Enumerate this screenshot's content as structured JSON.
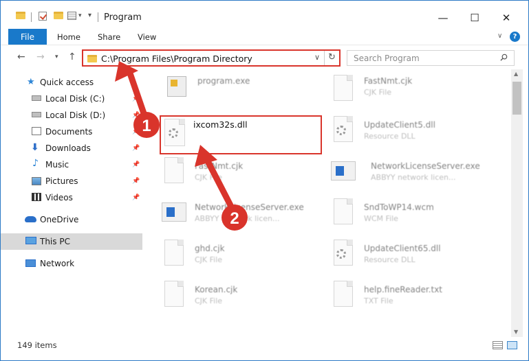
{
  "window": {
    "title": "Program",
    "controls": {
      "minimize": "—",
      "maximize": "☐",
      "close": "✕"
    }
  },
  "ribbon": {
    "tabs": [
      "File",
      "Home",
      "Share",
      "View"
    ],
    "help": "?"
  },
  "nav": {
    "address": "C:\\Program Files\\Program Directory",
    "search_placeholder": "Search Program"
  },
  "sidebar": {
    "items": [
      {
        "label": "Quick access",
        "icon": "star-icon",
        "pinned": false
      },
      {
        "label": "Local Disk (C:)",
        "icon": "drive-icon",
        "pinned": true
      },
      {
        "label": "Local Disk (D:)",
        "icon": "drive-icon",
        "pinned": true
      },
      {
        "label": "Documents",
        "icon": "documents-icon",
        "pinned": true
      },
      {
        "label": "Downloads",
        "icon": "download-icon",
        "pinned": true
      },
      {
        "label": "Music",
        "icon": "music-icon",
        "pinned": true
      },
      {
        "label": "Pictures",
        "icon": "pictures-icon",
        "pinned": true
      },
      {
        "label": "Videos",
        "icon": "videos-icon",
        "pinned": true
      },
      {
        "label": "OneDrive",
        "icon": "cloud-icon",
        "pinned": false
      },
      {
        "label": "This PC",
        "icon": "computer-icon",
        "pinned": false,
        "selected": true
      },
      {
        "label": "Network",
        "icon": "network-icon",
        "pinned": false
      }
    ]
  },
  "files": {
    "left": [
      {
        "name": "program.exe",
        "type": "",
        "icon": "exe-icon"
      },
      {
        "name": "ixcom32s.dll",
        "type": "",
        "icon": "dll-gear-icon",
        "highlighted": true
      },
      {
        "name": "FastNmt.cjk",
        "type": "CJK File",
        "icon": "file-icon"
      },
      {
        "name": "NetworkLicenseServer.exe",
        "type": "ABBYY network licen...",
        "icon": "app-window-icon"
      },
      {
        "name": "ghd.cjk",
        "type": "CJK File",
        "icon": "file-icon"
      },
      {
        "name": "Korean.cjk",
        "type": "CJK File",
        "icon": "file-icon"
      }
    ],
    "right": [
      {
        "name": "FastNmt.cjk",
        "type": "CJK File",
        "icon": "file-icon"
      },
      {
        "name": "UpdateClient5.dll",
        "type": "Resource DLL",
        "icon": "dll-gear-icon"
      },
      {
        "name": "NetworkLicenseServer.exe",
        "type": "ABBYY network licen...",
        "icon": "app-window-icon"
      },
      {
        "name": "SndToWP14.wcm",
        "type": "WCM File",
        "icon": "file-icon"
      },
      {
        "name": "UpdateClient65.dll",
        "type": "Resource DLL",
        "icon": "dll-gear-icon"
      },
      {
        "name": "help.fineReader.txt",
        "type": "TXT File",
        "icon": "file-icon"
      }
    ]
  },
  "status": {
    "item_count": "149 items"
  },
  "annotations": {
    "step1": "1",
    "step2": "2",
    "color": "#d9342b"
  }
}
